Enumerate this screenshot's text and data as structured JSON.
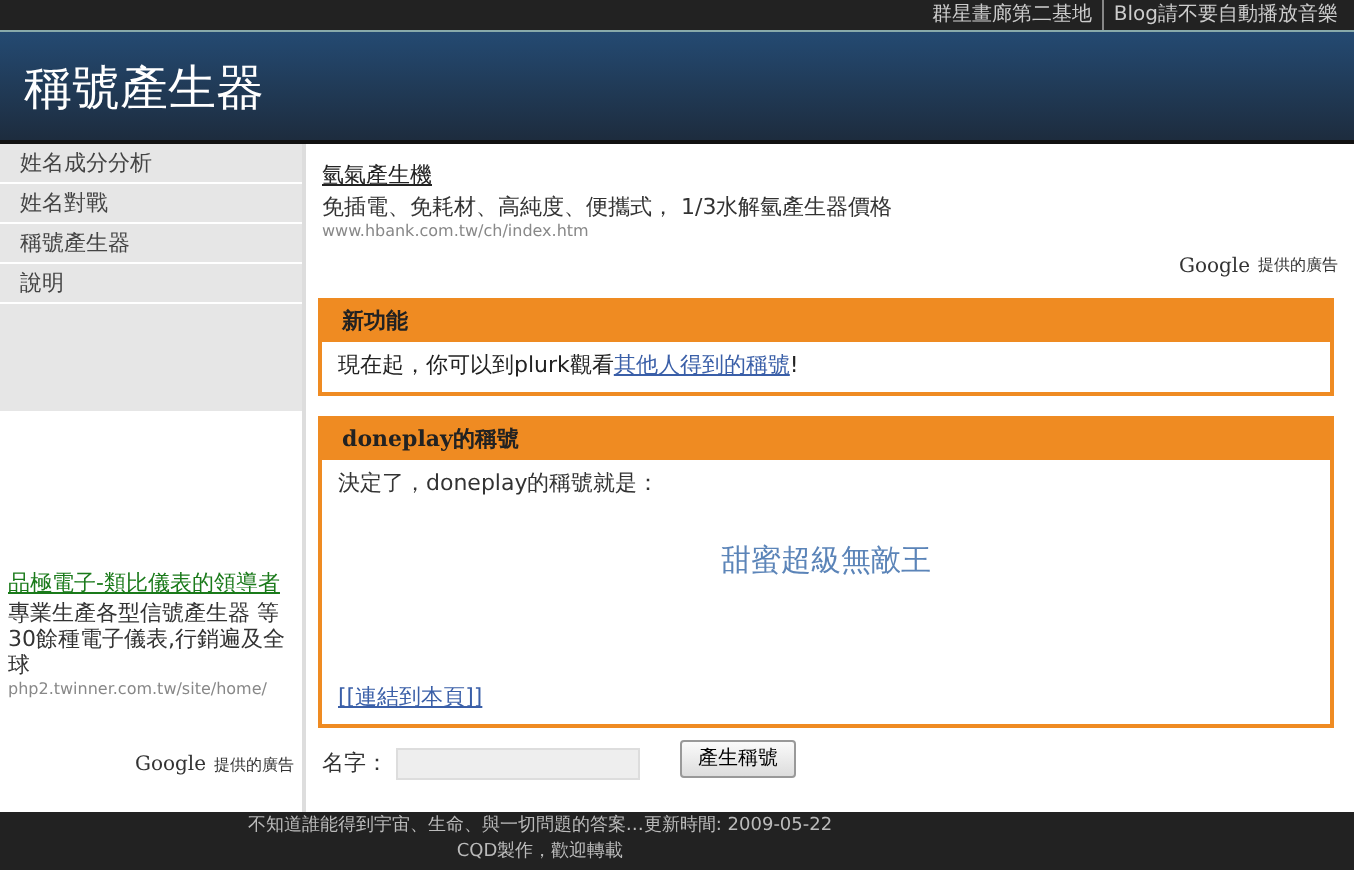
{
  "top_links": [
    "群星畫廊第二基地",
    "Blog請不要自動播放音樂"
  ],
  "site_title": "稱號產生器",
  "sidebar": {
    "items": [
      {
        "label": "姓名成分分析",
        "selected": false
      },
      {
        "label": "姓名對戰",
        "selected": false
      },
      {
        "label": "稱號產生器",
        "selected": false
      },
      {
        "label": "說明",
        "selected": false
      }
    ],
    "ad": {
      "title": "品極電子-類比儀表的領導者",
      "text": "專業生產各型信號產生器 等30餘種電子儀表,行銷遍及全球",
      "url": "php2.twinner.com.tw/site/home/",
      "attribution": "提供的廣告",
      "brand": "Google"
    }
  },
  "main_ad": {
    "title": "氫氣產生機",
    "text": "免插電、免耗材、高純度、便攜式， 1/3水解氫產生器價格",
    "url": "www.hbank.com.tw/ch/index.htm",
    "attribution": "提供的廣告",
    "brand": "Google"
  },
  "panels": [
    {
      "kind": "notice",
      "title": "新功能",
      "text": "現在起，你可以到plurk觀看",
      "link": "其他人得到的稱號",
      "suffix": "!"
    },
    {
      "kind": "result",
      "title": "doneplay的稱號",
      "text": "決定了，doneplay的稱號就是：",
      "result": "甜蜜超級無敵王",
      "link": "[[連結到本頁]]"
    }
  ],
  "form": {
    "label": "名字：",
    "button": "產生稱號"
  },
  "footer": [
    "不知道誰能得到宇宙、生命、與一切問題的答案…更新時間: 2009-05-22",
    "CQD製作，歡迎轉載"
  ]
}
